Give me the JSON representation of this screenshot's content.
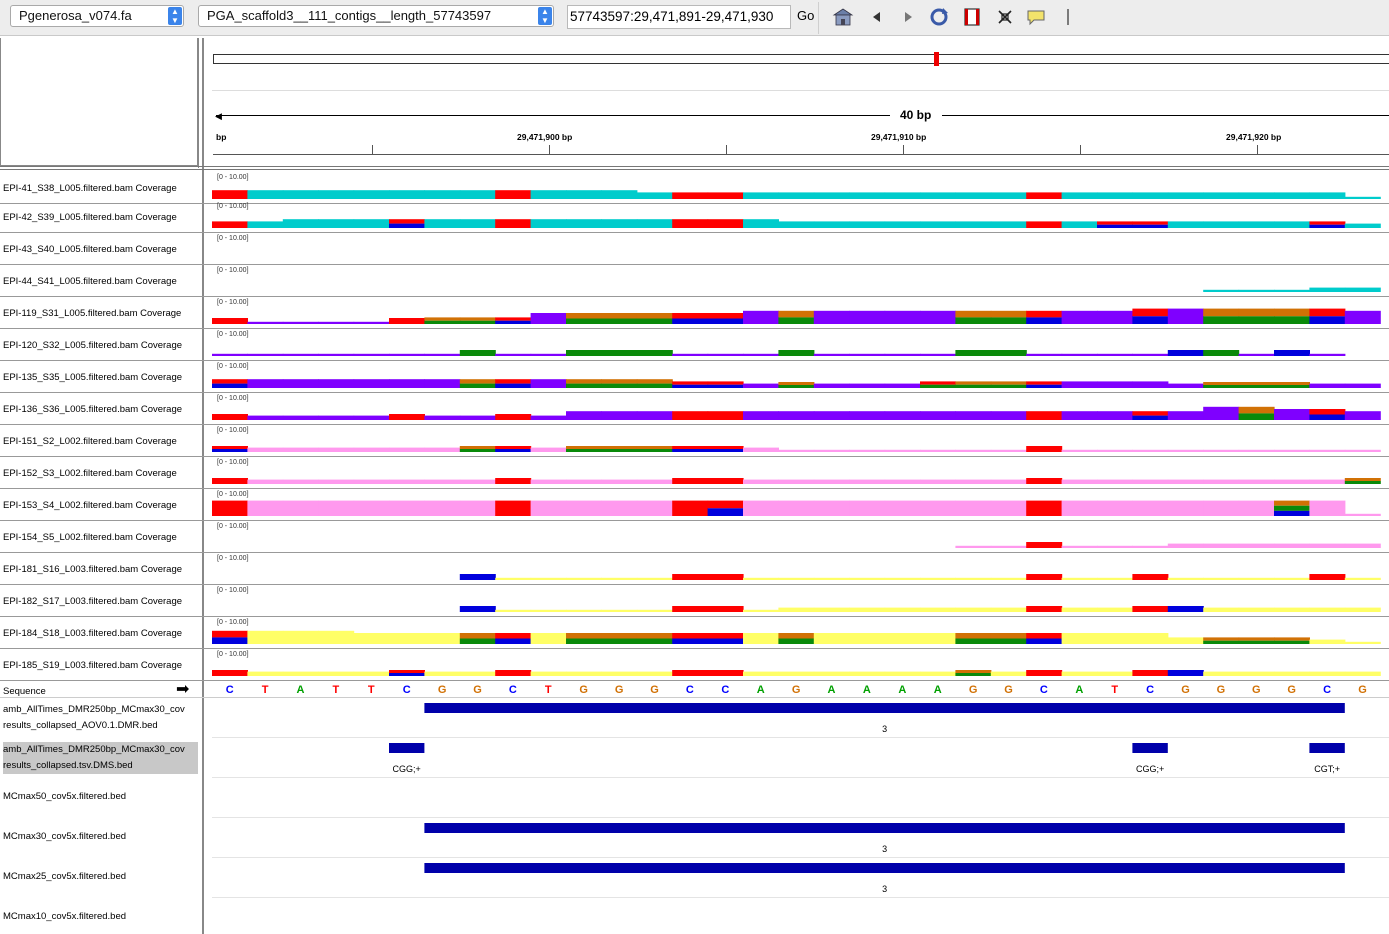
{
  "toolbar": {
    "genome": "Pgenerosa_v074.fa",
    "chromosome": "PGA_scaffold3__111_contigs__length_57743597",
    "locus": "57743597:29,471,891-29,471,930",
    "go_label": "Go",
    "icons": [
      "home-icon",
      "back-icon",
      "forward-icon",
      "refresh-icon",
      "region-icon",
      "resize-icon",
      "popup-icon"
    ]
  },
  "ruler": {
    "span_label": "40 bp",
    "bp_label": "bp",
    "ticks": [
      "29,471,900 bp",
      "29,471,910 bp",
      "29,471,920 bp"
    ]
  },
  "coverage_scale": "[0 - 10.00]",
  "coverage_tracks": [
    {
      "name": "EPI-41_S38_L005.filtered.bam Coverage",
      "color": "#00cccc"
    },
    {
      "name": "EPI-42_S39_L005.filtered.bam Coverage",
      "color": "#00cccc"
    },
    {
      "name": "EPI-43_S40_L005.filtered.bam Coverage",
      "color": "#00cccc"
    },
    {
      "name": "EPI-44_S41_L005.filtered.bam Coverage",
      "color": "#00cccc"
    },
    {
      "name": "EPI-119_S31_L005.filtered.bam Coverage",
      "color": "#7f00ff"
    },
    {
      "name": "EPI-120_S32_L005.filtered.bam Coverage",
      "color": "#7f00ff"
    },
    {
      "name": "EPI-135_S35_L005.filtered.bam Coverage",
      "color": "#7f00ff"
    },
    {
      "name": "EPI-136_S36_L005.filtered.bam Coverage",
      "color": "#7f00ff"
    },
    {
      "name": "EPI-151_S2_L002.filtered.bam Coverage",
      "color": "#ff99ee"
    },
    {
      "name": "EPI-152_S3_L002.filtered.bam Coverage",
      "color": "#ff99ee"
    },
    {
      "name": "EPI-153_S4_L002.filtered.bam Coverage",
      "color": "#ff99ee"
    },
    {
      "name": "EPI-154_S5_L002.filtered.bam Coverage",
      "color": "#ff99ee"
    },
    {
      "name": "EPI-181_S16_L003.filtered.bam Coverage",
      "color": "#ffff66"
    },
    {
      "name": "EPI-182_S17_L003.filtered.bam Coverage",
      "color": "#ffff66"
    },
    {
      "name": "EPI-184_S18_L003.filtered.bam Coverage",
      "color": "#ffff66"
    },
    {
      "name": "EPI-185_S19_L003.filtered.bam Coverage",
      "color": "#ffff66"
    }
  ],
  "sequence": {
    "label": "Sequence",
    "bases": [
      "C",
      "T",
      "A",
      "T",
      "T",
      "C",
      "G",
      "G",
      "C",
      "T",
      "G",
      "G",
      "G",
      "C",
      "C",
      "A",
      "G",
      "A",
      "A",
      "A",
      "A",
      "G",
      "G",
      "C",
      "A",
      "T",
      "C",
      "G",
      "G",
      "G",
      "G",
      "C",
      "G"
    ]
  },
  "base_colors": {
    "A": "#00a000",
    "C": "#0000ff",
    "G": "#d17105",
    "T": "#ff0000"
  },
  "feature_color": "#0000aa",
  "feature_tracks": [
    {
      "name_line1": "amb_AllTimes_DMR250bp_MCmax30_cov",
      "name_line2": "results_collapsed_AOV0.1.DMR.bed",
      "features": [
        {
          "label": "3"
        }
      ]
    },
    {
      "name_line1": "amb_AllTimes_DMR250bp_MCmax30_cov",
      "name_line2": "results_collapsed.tsv.DMS.bed",
      "features": [
        {
          "label": "CGG;+"
        },
        {
          "label": "CGG;+"
        },
        {
          "label": "CGT;+"
        }
      ]
    },
    {
      "name_line1": "MCmax50_cov5x.filtered.bed",
      "name_line2": "",
      "features": []
    },
    {
      "name_line1": "MCmax30_cov5x.filtered.bed",
      "name_line2": "",
      "features": [
        {
          "label": "3"
        }
      ]
    },
    {
      "name_line1": "MCmax25_cov5x.filtered.bed",
      "name_line2": "",
      "features": [
        {
          "label": "3"
        }
      ]
    },
    {
      "name_line1": "MCmax10_cov5x.filtered.bed",
      "name_line2": "",
      "features": []
    }
  ]
}
